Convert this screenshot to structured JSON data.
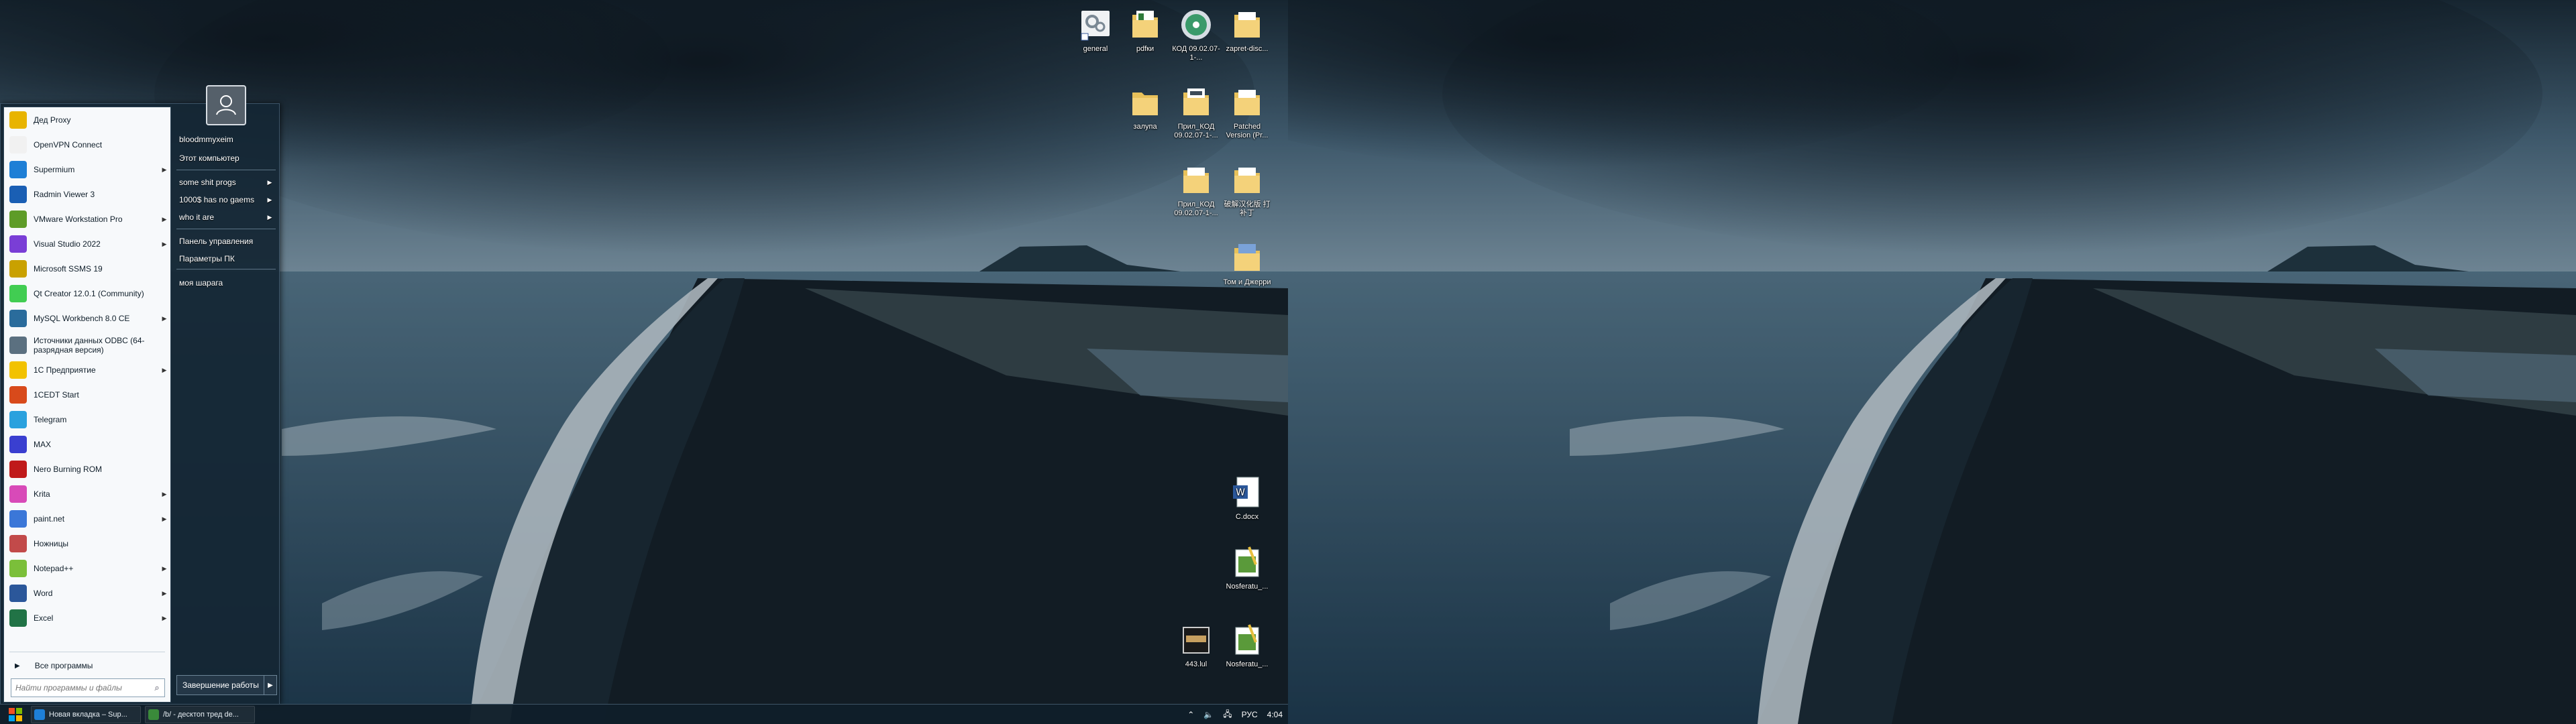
{
  "desktop_icons": [
    {
      "label": "general",
      "icon": "settings-shortcut-icon"
    },
    {
      "label": "pdfки",
      "icon": "folder-icon"
    },
    {
      "label": "КОД 09.02.07-1-...",
      "icon": "disc-icon"
    },
    {
      "label": "zapret-disc...",
      "icon": "folder-icon"
    },
    {
      "label": "залупа",
      "icon": "folder-icon"
    },
    {
      "label": "Прил_КОД 09.02.07-1-...",
      "icon": "folder-icon"
    },
    {
      "label": "Patched Version (Pr...",
      "icon": "folder-icon"
    },
    {
      "label": "Прил_КОД 09.02.07-1-...",
      "icon": "folder-icon"
    },
    {
      "label": "破解汉化版 打补丁",
      "icon": "folder-icon"
    },
    {
      "label": "Том и Джерри",
      "icon": "folder-icon"
    },
    {
      "label": "С.docx",
      "icon": "word-document-icon"
    },
    {
      "label": "Nosferatu_...",
      "icon": "image-file-icon"
    },
    {
      "label": "443.lul",
      "icon": "file-icon"
    },
    {
      "label": "Nosferatu_...",
      "icon": "image-file-icon"
    }
  ],
  "start_menu": {
    "programs": [
      {
        "label": "Дед Proxy",
        "arrow": false,
        "color": "#e8b400"
      },
      {
        "label": "OpenVPN Connect",
        "arrow": false,
        "color": "#f1f1f1"
      },
      {
        "label": "Supermium",
        "arrow": true,
        "color": "#1e7fd6"
      },
      {
        "label": "Radmin Viewer 3",
        "arrow": false,
        "color": "#1a5fb4"
      },
      {
        "label": "VMware Workstation Pro",
        "arrow": true,
        "color": "#5e9c28"
      },
      {
        "label": "Visual Studio 2022",
        "arrow": true,
        "color": "#7a3ed6"
      },
      {
        "label": "Microsoft SSMS 19",
        "arrow": false,
        "color": "#c9a100"
      },
      {
        "label": "Qt Creator 12.0.1 (Community)",
        "arrow": false,
        "color": "#41cd52"
      },
      {
        "label": "MySQL Workbench 8.0 CE",
        "arrow": true,
        "color": "#2a6c9c"
      },
      {
        "label": "Источники данных ODBC (64-разрядная версия)",
        "arrow": false,
        "color": "#5b7080"
      },
      {
        "label": "1С Предприятие",
        "arrow": true,
        "color": "#f2c200"
      },
      {
        "label": "1CEDT Start",
        "arrow": false,
        "color": "#d84a1b"
      },
      {
        "label": "Telegram",
        "arrow": false,
        "color": "#2aa1de"
      },
      {
        "label": "MAX",
        "arrow": false,
        "color": "#3a3fd0"
      },
      {
        "label": "Nero Burning ROM",
        "arrow": false,
        "color": "#c01a1a"
      },
      {
        "label": "Krita",
        "arrow": true,
        "color": "#d84ab8"
      },
      {
        "label": "paint.net",
        "arrow": true,
        "color": "#3b77d8"
      },
      {
        "label": "Ножницы",
        "arrow": false,
        "color": "#c24a4a"
      },
      {
        "label": "Notepad++",
        "arrow": true,
        "color": "#7bbf3a"
      },
      {
        "label": "Word",
        "arrow": true,
        "color": "#2b579a"
      },
      {
        "label": "Excel",
        "arrow": true,
        "color": "#217346"
      }
    ],
    "all_programs": "Все программы",
    "search_placeholder": "Найти программы и файлы",
    "right_items": [
      {
        "label": "bloodmmyxeim",
        "arrow": false
      },
      {
        "label": "Этот компьютер",
        "arrow": false
      },
      {
        "label": "some shit progs",
        "arrow": true
      },
      {
        "label": "1000$ has no gaems",
        "arrow": true
      },
      {
        "label": "who it are",
        "arrow": true
      },
      {
        "label": "Панель управления",
        "arrow": false
      },
      {
        "label": "Параметры ПК",
        "arrow": false
      },
      {
        "label": "моя шарага",
        "arrow": false
      }
    ],
    "shutdown_label": "Завершение работы"
  },
  "taskbar": {
    "items": [
      {
        "label": "Новая вкладка – Sup...",
        "color": "#1e7fd6"
      },
      {
        "label": "/b/ - десктоп тред de...",
        "color": "#3a8a3a"
      }
    ],
    "tray": {
      "chevron": "⌃",
      "language": "РУС",
      "time": "4:04"
    }
  }
}
